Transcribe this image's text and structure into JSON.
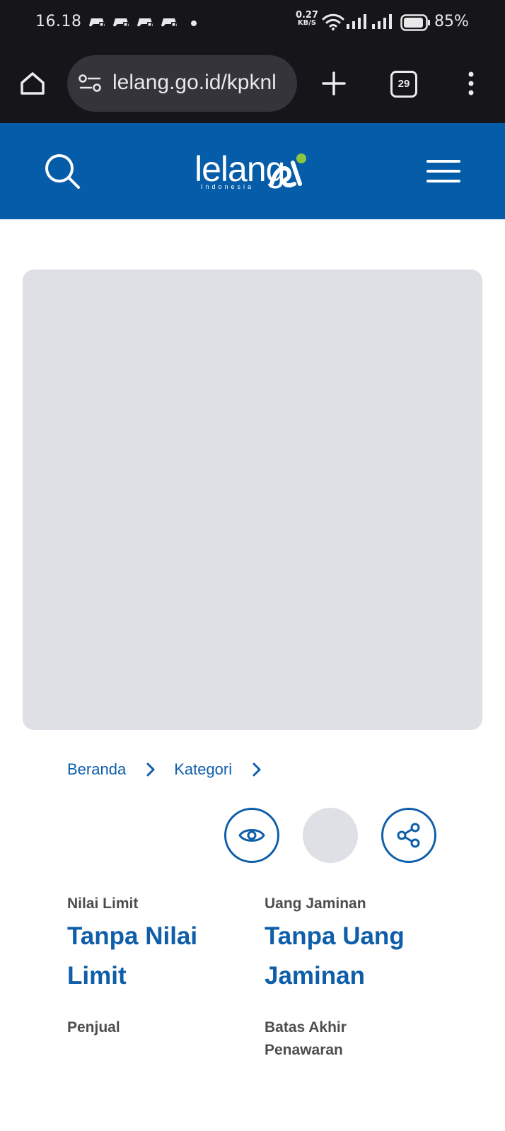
{
  "status_bar": {
    "time": "16.18",
    "net_speed_value": "0.27",
    "net_speed_unit": "KB/S",
    "battery_percent": "85%",
    "notification_icons": [
      "game-controller-icon",
      "game-controller-icon",
      "game-controller-icon",
      "game-controller-icon"
    ]
  },
  "browser": {
    "url": "lelang.go.id/kpknl",
    "tab_count": "29"
  },
  "site_header": {
    "logo_text": "lelang",
    "logo_subtext": "Indonesia",
    "brand_color": "#055ca9",
    "accent_color": "#8dc63f"
  },
  "breadcrumb": {
    "items": [
      "Beranda",
      "Kategori"
    ]
  },
  "info": {
    "nilai_limit_label": "Nilai Limit",
    "nilai_limit_value_line1": "Tanpa Nilai",
    "nilai_limit_value_line2": "Limit",
    "uang_jaminan_label": "Uang Jaminan",
    "uang_jaminan_value_line1": "Tanpa Uang",
    "uang_jaminan_value_line2": "Jaminan",
    "penjual_label": "Penjual",
    "batas_label_line1": "Batas Akhir",
    "batas_label_line2": "Penawaran"
  },
  "colors": {
    "link_blue": "#0f5ea9",
    "placeholder_gray": "#dee0e5"
  }
}
